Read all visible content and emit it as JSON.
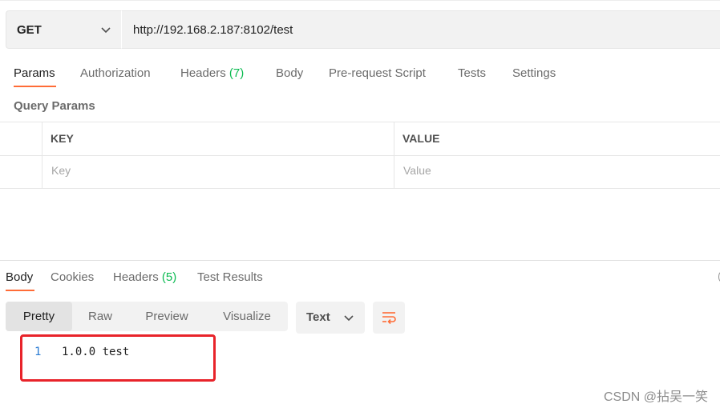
{
  "request": {
    "method": "GET",
    "url": "http://192.168.2.187:8102/test"
  },
  "request_tabs": [
    {
      "label": "Params",
      "active": true
    },
    {
      "label": "Authorization"
    },
    {
      "label": "Headers",
      "count": "(7)"
    },
    {
      "label": "Body"
    },
    {
      "label": "Pre-request Script"
    },
    {
      "label": "Tests"
    },
    {
      "label": "Settings"
    }
  ],
  "query_params": {
    "title": "Query Params",
    "headers": {
      "key": "KEY",
      "value": "VALUE"
    },
    "placeholders": {
      "key": "Key",
      "value": "Value"
    }
  },
  "response_tabs": [
    {
      "label": "Body",
      "active": true
    },
    {
      "label": "Cookies"
    },
    {
      "label": "Headers",
      "count": "(5)"
    },
    {
      "label": "Test Results"
    }
  ],
  "view_modes": [
    {
      "label": "Pretty",
      "active": true
    },
    {
      "label": "Raw"
    },
    {
      "label": "Preview"
    },
    {
      "label": "Visualize"
    }
  ],
  "format_select": {
    "selected": "Text"
  },
  "response_body": {
    "lines": [
      {
        "number": "1",
        "text": "1.0.0 test"
      }
    ]
  },
  "watermark": "CSDN @拈吴一笑",
  "colors": {
    "accent": "#ff6c37",
    "count_green": "#0cbb52",
    "highlight_red": "#e8232a",
    "line_number_blue": "#2a7bd3"
  },
  "icons": {
    "method_dropdown": "chevron-down-icon",
    "format_dropdown": "chevron-down-icon",
    "wrap": "wrap-lines-icon"
  }
}
